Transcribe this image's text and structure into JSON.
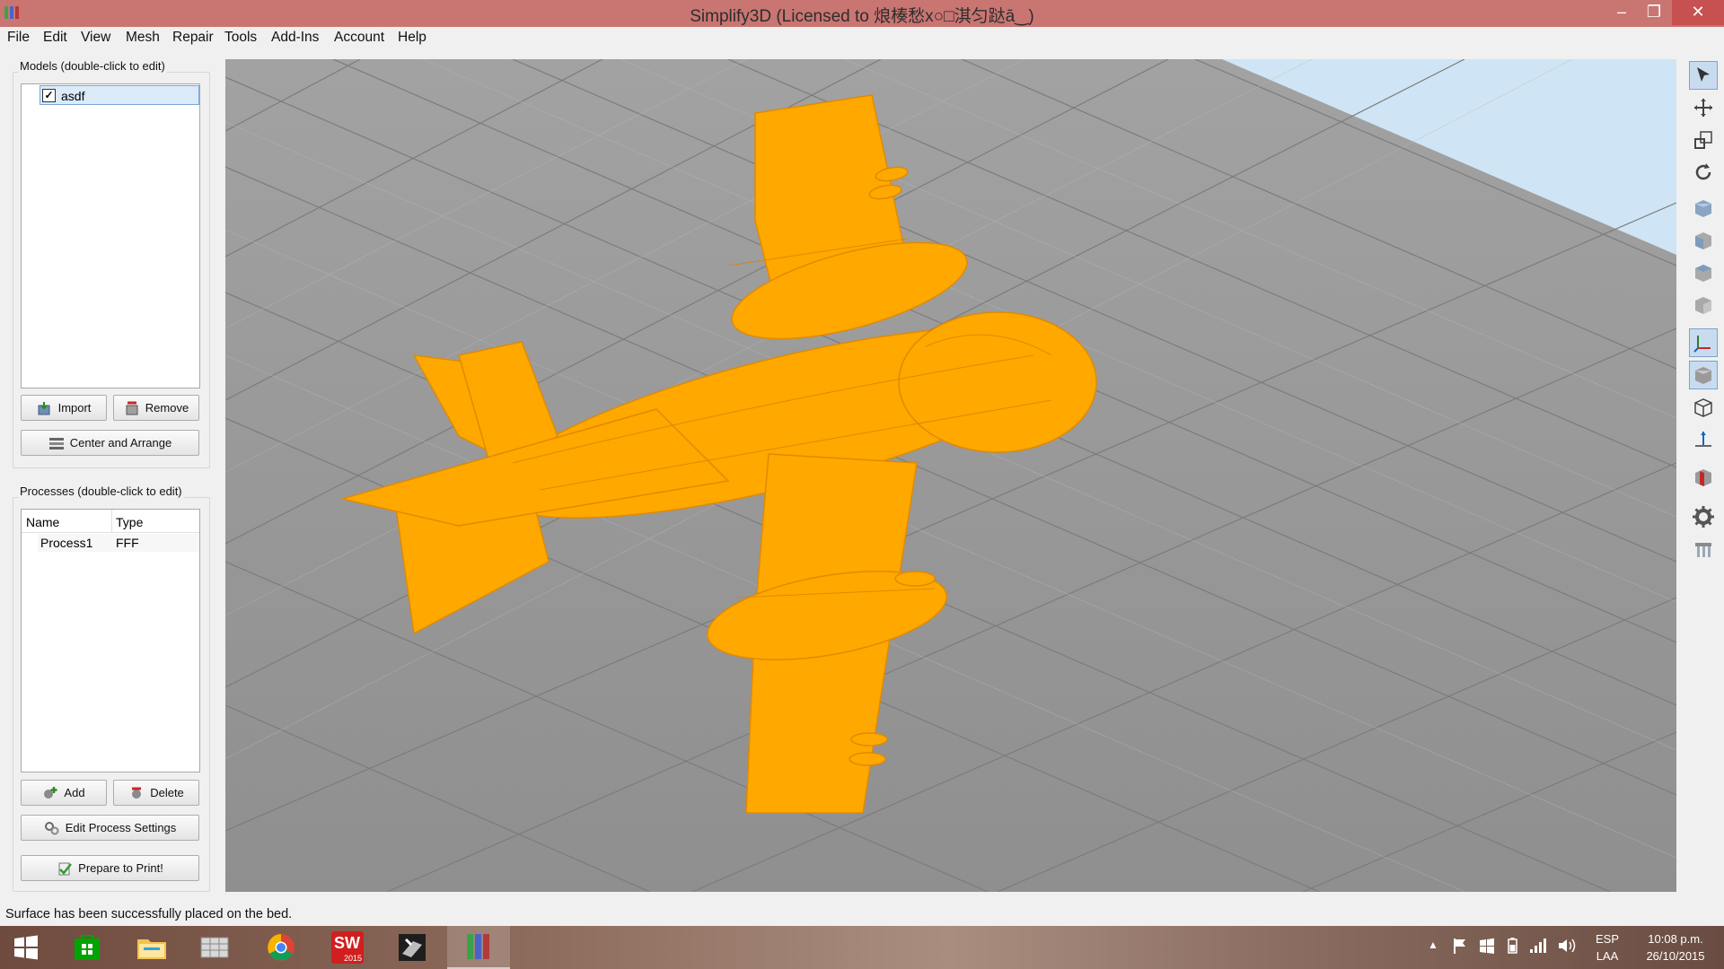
{
  "window": {
    "title": "Simplify3D (Licensed to 烺楱愁x○□淇匀跶ā‿)",
    "minimize_glyph": "–",
    "maximize_glyph": "❐",
    "close_glyph": "✕"
  },
  "menu": [
    "File",
    "Edit",
    "View",
    "Mesh",
    "Repair",
    "Tools",
    "Add-Ins",
    "Account",
    "Help"
  ],
  "models": {
    "label": "Models (double-click to edit)",
    "items": [
      {
        "name": "asdf",
        "checked": true
      }
    ],
    "import_label": "Import",
    "remove_label": "Remove",
    "center_label": "Center and Arrange"
  },
  "processes": {
    "label": "Processes (double-click to edit)",
    "columns": [
      "Name",
      "Type"
    ],
    "rows": [
      {
        "name": "Process1",
        "type": "FFF"
      }
    ],
    "add_label": "Add",
    "delete_label": "Delete",
    "edit_label": "Edit Process Settings",
    "prepare_label": "Prepare to Print!"
  },
  "viewport": {
    "bed_color": "#9b9b9b",
    "sky_color": "#cfe5f5",
    "model_color": "#ffa800"
  },
  "toolbar": [
    "select-icon",
    "move-icon",
    "scale-icon",
    "rotate-icon",
    "view-default-icon",
    "view-front-icon",
    "view-top-icon",
    "view-side-icon",
    "axes-icon",
    "solid-view-icon",
    "wireframe-icon",
    "normals-icon",
    "cross-section-icon",
    "settings-gear-icon",
    "support-icon"
  ],
  "status": "Surface has been successfully placed on the bed.",
  "taskbar": {
    "apps": [
      "windows-start-icon",
      "store-icon",
      "file-explorer-icon",
      "spreadsheet-app-icon",
      "chrome-icon",
      "solidworks-icon",
      "cad-tool-icon",
      "simplify3d-icon"
    ],
    "solidworks_year": "2015",
    "language_top": "ESP",
    "language_bottom": "LAA",
    "time": "10:08 p.m.",
    "date": "26/10/2015"
  }
}
